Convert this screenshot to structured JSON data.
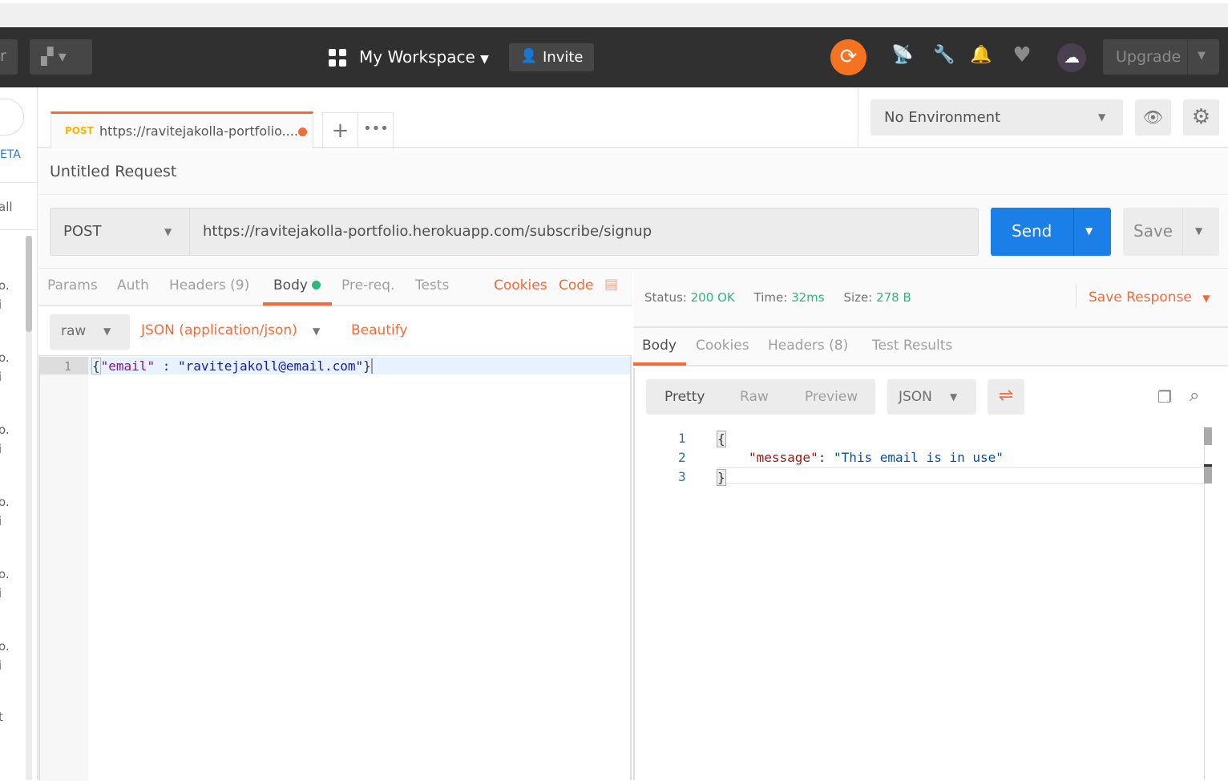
{
  "header": {
    "workspace": "My Workspace",
    "invite": "Invite",
    "upgrade": "Upgrade",
    "left_partial": "r"
  },
  "sidebar": {
    "partial_top": "ETA",
    "partial_all": "all",
    "rows": [
      "o.",
      "i",
      "o.",
      "i",
      "o.",
      "i",
      "o.",
      "i",
      "o.",
      "i",
      "o.",
      "i",
      "t"
    ]
  },
  "tab": {
    "method": "POST",
    "title": "https://ravitejakolla-portfolio....",
    "unsaved_color": "#f26b3a"
  },
  "environment": {
    "selected": "No Environment"
  },
  "request": {
    "name": "Untitled Request",
    "method": "POST",
    "url": "https://ravitejakolla-portfolio.herokuapp.com/subscribe/signup",
    "send": "Send",
    "save": "Save"
  },
  "request_tabs": {
    "params": "Params",
    "auth": "Auth",
    "headers": "Headers",
    "headers_count": "(9)",
    "body": "Body",
    "prereq": "Pre-req.",
    "tests": "Tests",
    "cookies": "Cookies",
    "code": "Code",
    "active": "Body"
  },
  "body_options": {
    "mode": "raw",
    "content_type": "JSON (application/json)",
    "beautify": "Beautify"
  },
  "request_body": {
    "line_number": "1",
    "open": "{",
    "key": "\"email\"",
    "sep": " : ",
    "value": "\"ravitejakoll@email.com\"",
    "close": "}"
  },
  "response": {
    "status_label": "Status:",
    "status": "200 OK",
    "time_label": "Time:",
    "time": "32ms",
    "size_label": "Size:",
    "size": "278 B",
    "save_response": "Save Response",
    "tabs": {
      "body": "Body",
      "cookies": "Cookies",
      "headers": "Headers",
      "headers_count": "(8)",
      "test_results": "Test Results",
      "active": "Body"
    },
    "view": {
      "pretty": "Pretty",
      "raw": "Raw",
      "preview": "Preview",
      "format": "JSON",
      "active": "Pretty"
    },
    "lines": [
      {
        "n": "1",
        "text": "{"
      },
      {
        "n": "2",
        "key": "\"message\"",
        "colon": ": ",
        "value": "\"This email is in use\""
      },
      {
        "n": "3",
        "text": "}"
      }
    ]
  },
  "colors": {
    "accent": "#f26b3a",
    "send": "#1a7fe6",
    "success": "#2eb67d",
    "header_bg": "#303030",
    "sync": "#f47321"
  }
}
